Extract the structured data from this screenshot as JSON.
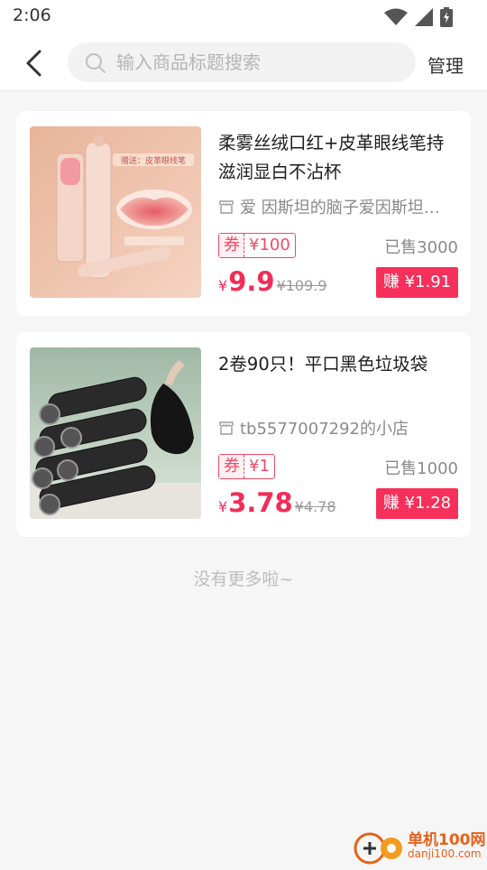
{
  "status_bar": {
    "time": "2:06"
  },
  "header": {
    "search_placeholder": "输入商品标题搜索",
    "manage_label": "管理"
  },
  "products": [
    {
      "image_caption": "赠送：皮革眼线笔",
      "title": "柔雾丝绒口红+皮革眼线笔持滋润显白不沾杯",
      "shop_name": "爱 因斯坦的脑子爱因斯坦…",
      "coupon_tag": "券",
      "coupon_value": "¥100",
      "sold": "已售3000",
      "yen": "¥",
      "price": "9.9",
      "original_price": "¥109.9",
      "earn_label": "赚 ¥1.91"
    },
    {
      "title": "2卷90只！平口黑色垃圾袋",
      "shop_name": "tb5577007292的小店",
      "coupon_tag": "券",
      "coupon_value": "¥1",
      "sold": "已售1000",
      "yen": "¥",
      "price": "3.78",
      "original_price": "¥4.78",
      "earn_label": "赚 ¥1.28"
    }
  ],
  "footer": {
    "no_more": "没有更多啦~"
  },
  "watermark": {
    "name": "单机100网",
    "domain": "danji100.com"
  },
  "colors": {
    "accent": "#f5305a",
    "coupon": "#f04a68",
    "price": "#f22d58"
  },
  "icons": [
    "wifi-icon",
    "signal-icon",
    "battery-icon",
    "back-arrow-icon",
    "search-icon",
    "shop-icon"
  ]
}
